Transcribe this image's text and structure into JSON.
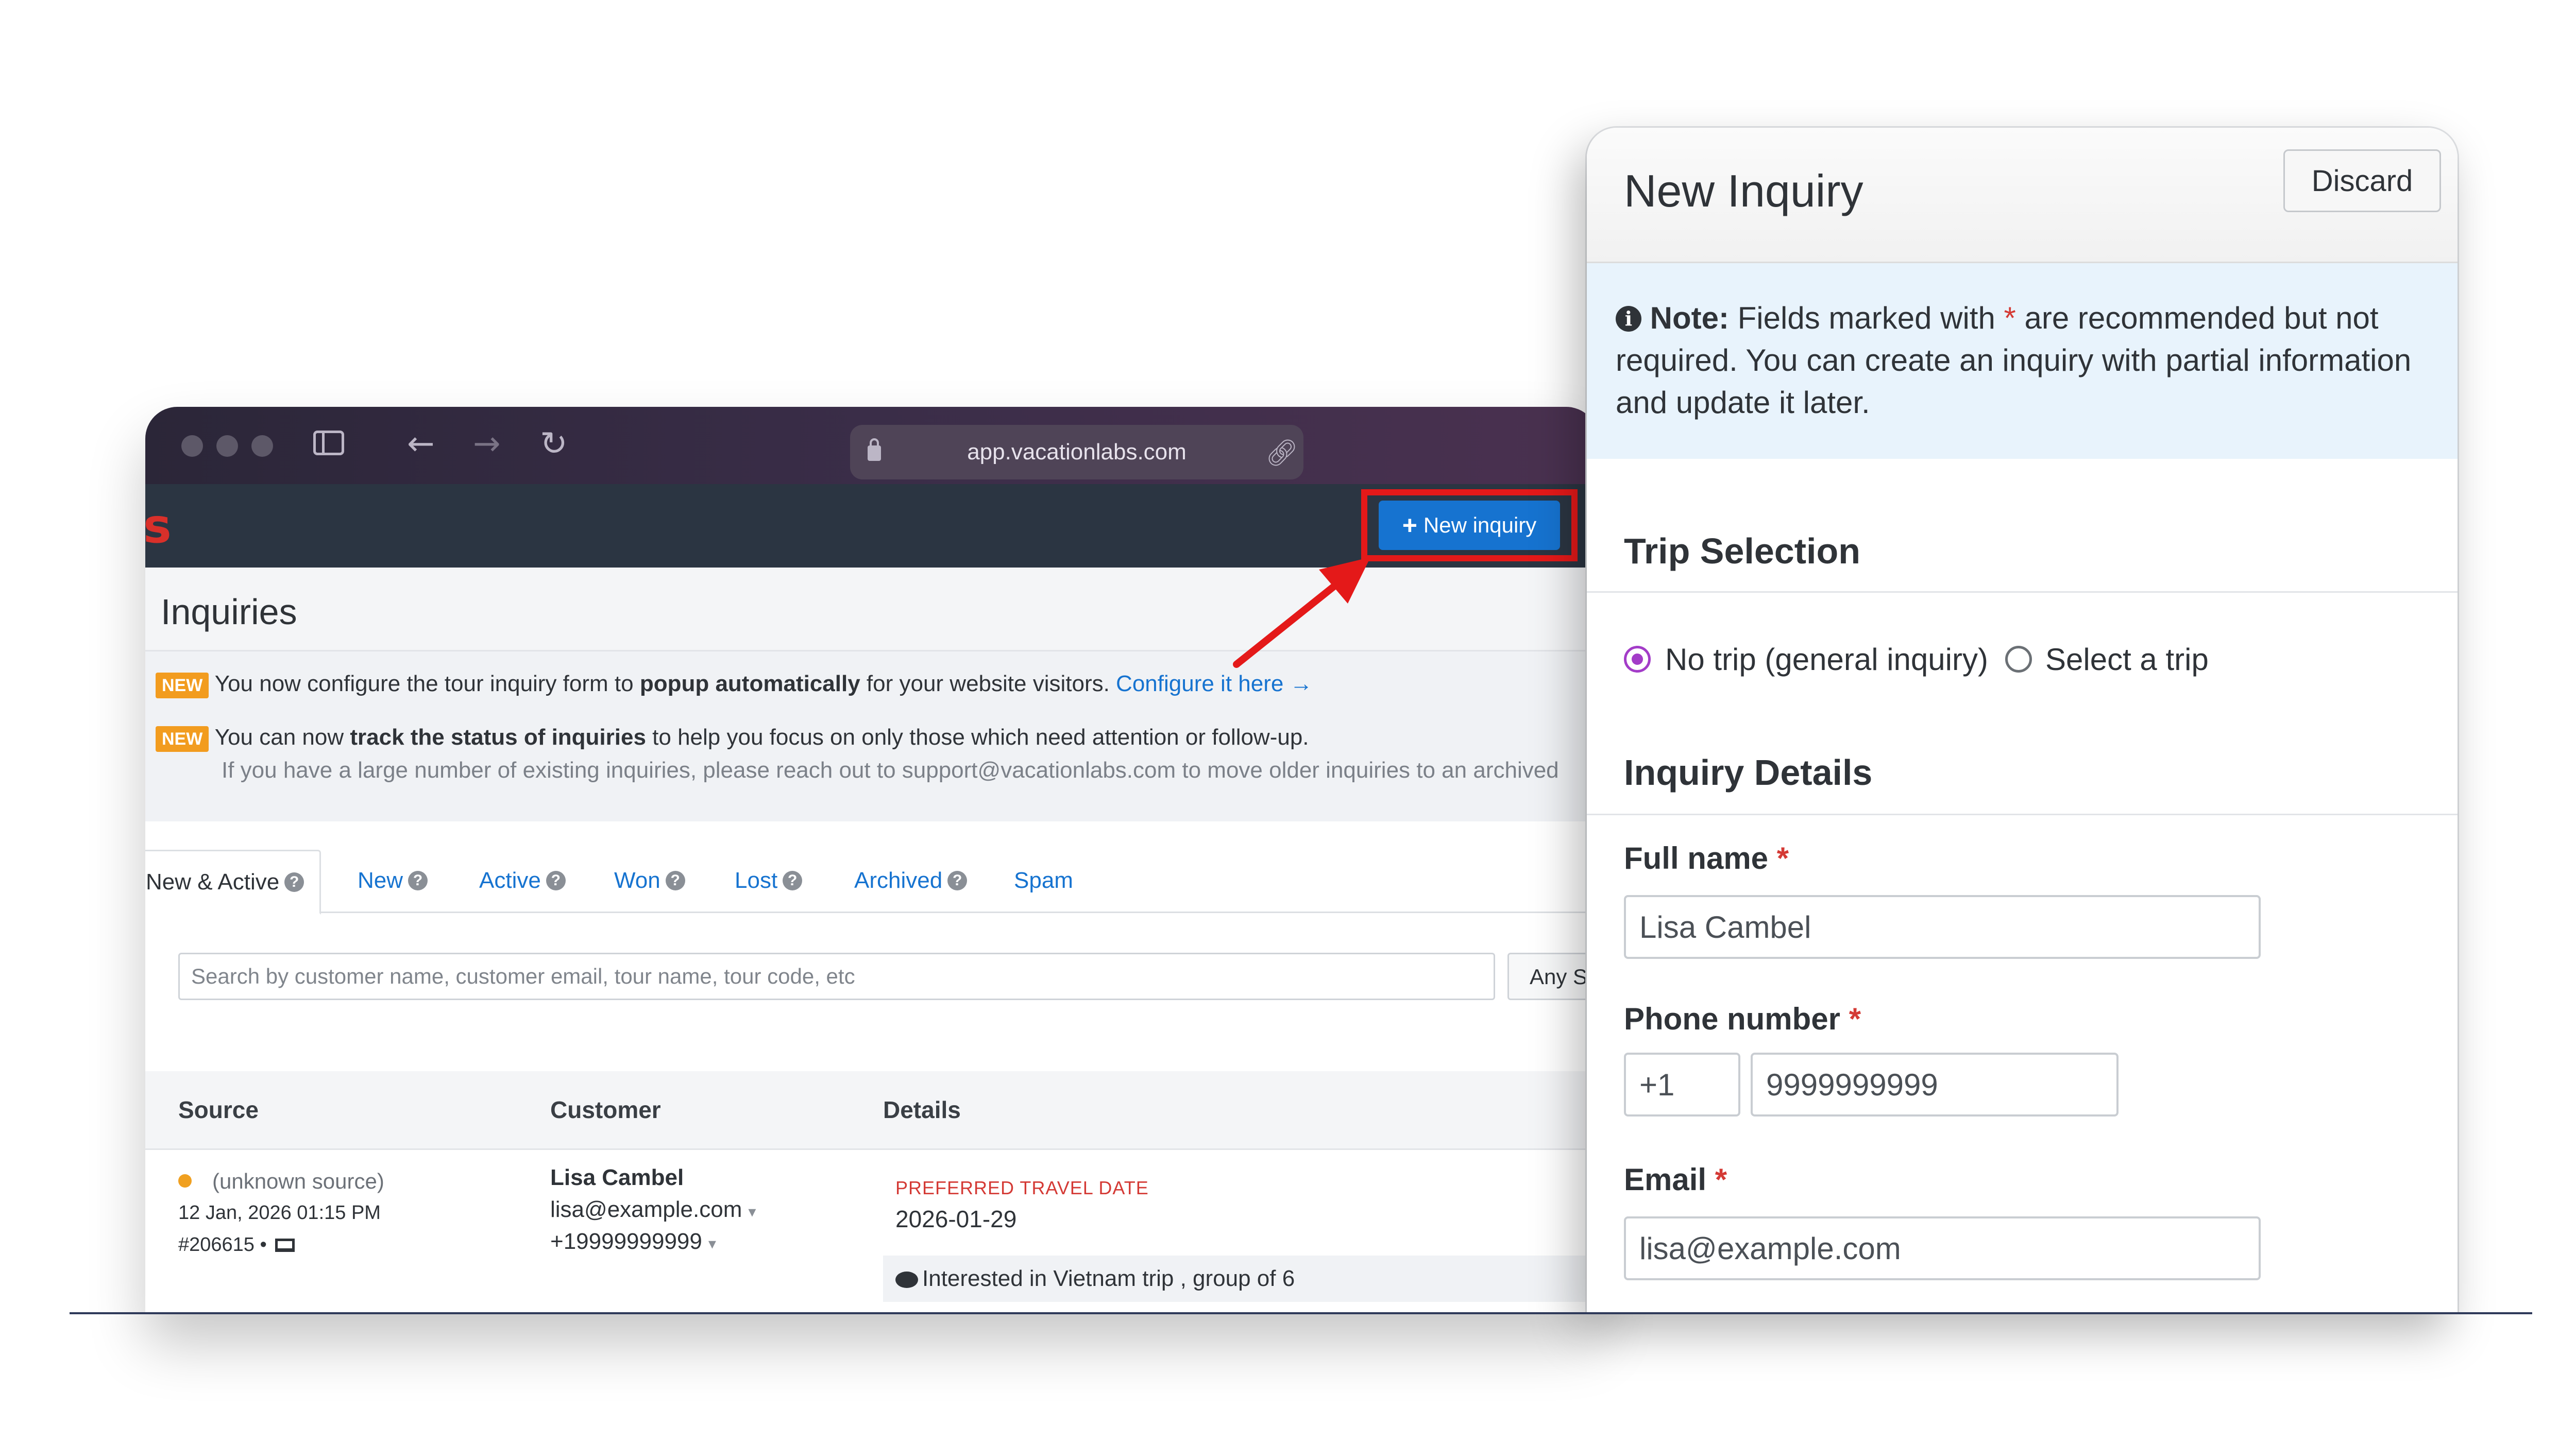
{
  "browser": {
    "url": "app.vacationlabs.com",
    "brand_fragment": "s"
  },
  "app": {
    "new_inquiry_button": "New inquiry",
    "page_title": "Inquiries",
    "announcements": [
      {
        "badge": "NEW",
        "text_before": "You now configure the tour inquiry form to ",
        "text_bold": "popup automatically",
        "text_after": " for your website visitors. ",
        "link": "Configure it here →"
      },
      {
        "badge": "NEW",
        "text_before": "You can now ",
        "text_bold": "track the status of inquiries",
        "text_after": " to help you focus on only those which need attention or follow-up.",
        "subtext": "If you have a large number of existing inquiries, please reach out to support@vacationlabs.com to move older inquiries to an archived"
      }
    ],
    "tabs": [
      {
        "label": "New & Active",
        "help": "?"
      },
      {
        "label": "New",
        "help": "?"
      },
      {
        "label": "Active",
        "help": "?"
      },
      {
        "label": "Won",
        "help": "?"
      },
      {
        "label": "Lost",
        "help": "?"
      },
      {
        "label": "Archived",
        "help": "?"
      },
      {
        "label": "Spam"
      }
    ],
    "search": {
      "placeholder": "Search by customer name, customer email, tour name, tour code, etc",
      "filter_label": "Any S"
    },
    "table": {
      "columns": [
        "Source",
        "Customer",
        "Details"
      ],
      "rows": [
        {
          "source": "(unknown source)",
          "date": "12 Jan, 2026 01:15 PM",
          "id": "#206615 •",
          "customer_name": "Lisa Cambel",
          "customer_email": "lisa@example.com",
          "customer_phone": "+19999999999",
          "detail_label": "PREFERRED TRAVEL DATE",
          "detail_value": "2026-01-29",
          "note": "Interested in Vietnam trip , group of 6"
        }
      ]
    }
  },
  "panel": {
    "title": "New Inquiry",
    "discard_button": "Discard",
    "note": {
      "label": "Note:",
      "text_before": " Fields marked with ",
      "asterisk": "*",
      "text_after": " are recommended but not required. You can create an inquiry with partial information and update it later."
    },
    "trip_selection": {
      "heading": "Trip Selection",
      "options": [
        "No trip (general inquiry)",
        "Select a trip"
      ],
      "selected": "No trip (general inquiry)"
    },
    "inquiry_details": {
      "heading": "Inquiry Details",
      "full_name_label": "Full name",
      "full_name_value": "Lisa Cambel",
      "phone_label": "Phone number",
      "phone_code": "+1",
      "phone_value": "9999999999",
      "email_label": "Email",
      "email_value": "lisa@example.com",
      "required_marker": "*"
    }
  },
  "colors": {
    "accent_blue": "#1673d0",
    "highlight_red": "#e41919",
    "new_badge": "#f29c1f",
    "radio_selected": "#a33cc8"
  }
}
